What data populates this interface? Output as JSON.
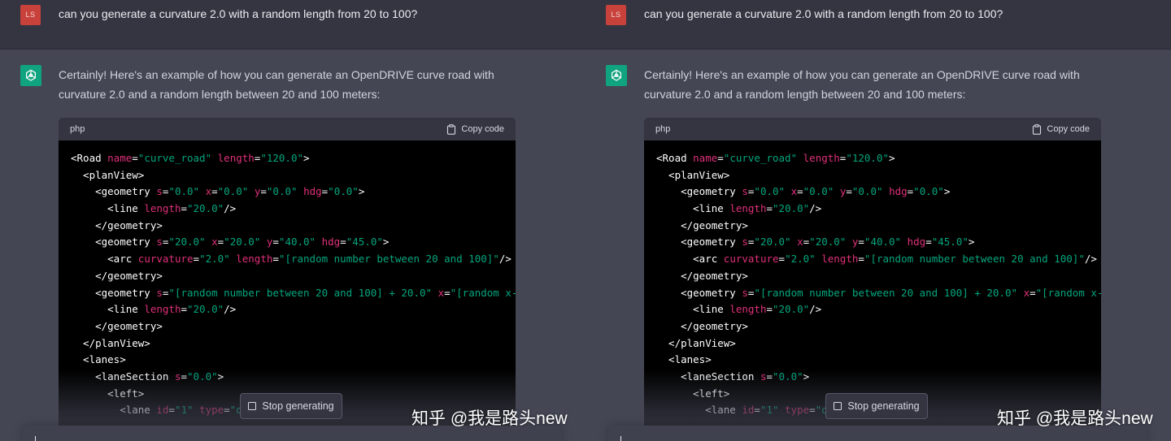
{
  "user_message": {
    "avatar_initials": "LS",
    "text": "can you generate a curvature 2.0 with a random length from 20 to 100?"
  },
  "assistant_message": {
    "text": "Certainly! Here's an example of how you can generate an OpenDRIVE curve road with curvature 2.0 and a random length between 20 and 100 meters:"
  },
  "code_block": {
    "language": "php",
    "copy_label": "Copy code",
    "lines": [
      [
        [
          "tag",
          "<Road "
        ],
        [
          "attr",
          "name"
        ],
        [
          "eq",
          "="
        ],
        [
          "val",
          "\"curve_road\""
        ],
        [
          "tag",
          " "
        ],
        [
          "attr",
          "length"
        ],
        [
          "eq",
          "="
        ],
        [
          "val",
          "\"120.0\""
        ],
        [
          "tag",
          ">"
        ]
      ],
      [
        [
          "tag",
          "  <planView>"
        ]
      ],
      [
        [
          "tag",
          "    <geometry "
        ],
        [
          "attr",
          "s"
        ],
        [
          "eq",
          "="
        ],
        [
          "val",
          "\"0.0\""
        ],
        [
          "tag",
          " "
        ],
        [
          "attr",
          "x"
        ],
        [
          "eq",
          "="
        ],
        [
          "val",
          "\"0.0\""
        ],
        [
          "tag",
          " "
        ],
        [
          "attr",
          "y"
        ],
        [
          "eq",
          "="
        ],
        [
          "val",
          "\"0.0\""
        ],
        [
          "tag",
          " "
        ],
        [
          "attr",
          "hdg"
        ],
        [
          "eq",
          "="
        ],
        [
          "val",
          "\"0.0\""
        ],
        [
          "tag",
          ">"
        ]
      ],
      [
        [
          "tag",
          "      <line "
        ],
        [
          "attr",
          "length"
        ],
        [
          "eq",
          "="
        ],
        [
          "val",
          "\"20.0\""
        ],
        [
          "tag",
          "/>"
        ]
      ],
      [
        [
          "tag",
          "    </geometry>"
        ]
      ],
      [
        [
          "tag",
          "    <geometry "
        ],
        [
          "attr",
          "s"
        ],
        [
          "eq",
          "="
        ],
        [
          "val",
          "\"20.0\""
        ],
        [
          "tag",
          " "
        ],
        [
          "attr",
          "x"
        ],
        [
          "eq",
          "="
        ],
        [
          "val",
          "\"20.0\""
        ],
        [
          "tag",
          " "
        ],
        [
          "attr",
          "y"
        ],
        [
          "eq",
          "="
        ],
        [
          "val",
          "\"40.0\""
        ],
        [
          "tag",
          " "
        ],
        [
          "attr",
          "hdg"
        ],
        [
          "eq",
          "="
        ],
        [
          "val",
          "\"45.0\""
        ],
        [
          "tag",
          ">"
        ]
      ],
      [
        [
          "tag",
          "      <arc "
        ],
        [
          "attr",
          "curvature"
        ],
        [
          "eq",
          "="
        ],
        [
          "val",
          "\"2.0\""
        ],
        [
          "tag",
          " "
        ],
        [
          "attr",
          "length"
        ],
        [
          "eq",
          "="
        ],
        [
          "val",
          "\"[random number between 20 and 100]\""
        ],
        [
          "tag",
          "/>"
        ]
      ],
      [
        [
          "tag",
          "    </geometry>"
        ]
      ],
      [
        [
          "tag",
          "    <geometry "
        ],
        [
          "attr",
          "s"
        ],
        [
          "eq",
          "="
        ],
        [
          "val",
          "\"[random number between 20 and 100] + 20.0\""
        ],
        [
          "tag",
          " "
        ],
        [
          "attr",
          "x"
        ],
        [
          "eq",
          "="
        ],
        [
          "val",
          "\"[random x-coo"
        ]
      ],
      [
        [
          "tag",
          "      <line "
        ],
        [
          "attr",
          "length"
        ],
        [
          "eq",
          "="
        ],
        [
          "val",
          "\"20.0\""
        ],
        [
          "tag",
          "/>"
        ]
      ],
      [
        [
          "tag",
          "    </geometry>"
        ]
      ],
      [
        [
          "tag",
          "  </planView>"
        ]
      ],
      [
        [
          "tag",
          "  <lanes>"
        ]
      ],
      [
        [
          "tag",
          "    <laneSection "
        ],
        [
          "attr",
          "s"
        ],
        [
          "eq",
          "="
        ],
        [
          "val",
          "\"0.0\""
        ],
        [
          "tag",
          ">"
        ]
      ],
      [
        [
          "tag",
          "      <left>"
        ]
      ],
      [
        [
          "tag",
          "        <lane "
        ],
        [
          "attr",
          "id"
        ],
        [
          "eq",
          "="
        ],
        [
          "val",
          "\"1\""
        ],
        [
          "tag",
          " "
        ],
        [
          "attr",
          "type"
        ],
        [
          "eq",
          "="
        ],
        [
          "val",
          "\"dr"
        ]
      ]
    ]
  },
  "stop_button": {
    "label": "Stop generating"
  },
  "watermark": {
    "text": "知乎 @我是路头new"
  },
  "colors": {
    "background": "#444654",
    "user_row": "#343541",
    "user_avatar": "#c9413b",
    "gpt_avatar": "#10a37f",
    "code_bg": "#000000",
    "attr": "#df3079",
    "value": "#00a67d"
  }
}
